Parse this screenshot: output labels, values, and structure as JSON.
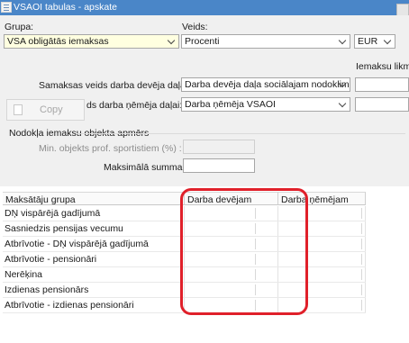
{
  "window": {
    "title": "VSAOI tabulas - apskate"
  },
  "form": {
    "grupa_label": "Grupa:",
    "grupa_value": "VSA obligātās iemaksas",
    "veids_label": "Veids:",
    "veids_value": "Procenti",
    "currency_value": "EUR",
    "iemaksu_likme_label": "Iemaksu likme",
    "employer_label": "Samaksas veids darba devēja daļai:",
    "employer_value": "Darba devēja daļa sociālajam nodoklim",
    "employee_label_partial": "ds darba ņēmēja daļai:",
    "employee_value": "Darba ņēmēja VSAOI",
    "group_box_title": "Nodokļa iemaksu objekta apmērs",
    "min_objects_label": "Min. objekts prof. sportistiem (%) :",
    "max_sum_label": "Maksimālā summa:"
  },
  "context_menu": {
    "copy_label": "Copy"
  },
  "grid": {
    "columns": [
      "Maksātāju grupa",
      "Darba devējam",
      "Darba ņēmējam"
    ],
    "rows": [
      "DŅ vispārējā gadījumā",
      "Sasniedzis pensijas vecumu",
      "Atbrīvotie - DŅ vispārējā gadījumā",
      "Atbrīvotie - pensionāri",
      "Nerēķina",
      "Izdienas pensionārs",
      "Atbrīvotie - izdienas pensionāri"
    ]
  },
  "colors": {
    "title_bar": "#4a86c8",
    "highlight": "#e0202a",
    "yellow_field": "#ffffe0"
  }
}
